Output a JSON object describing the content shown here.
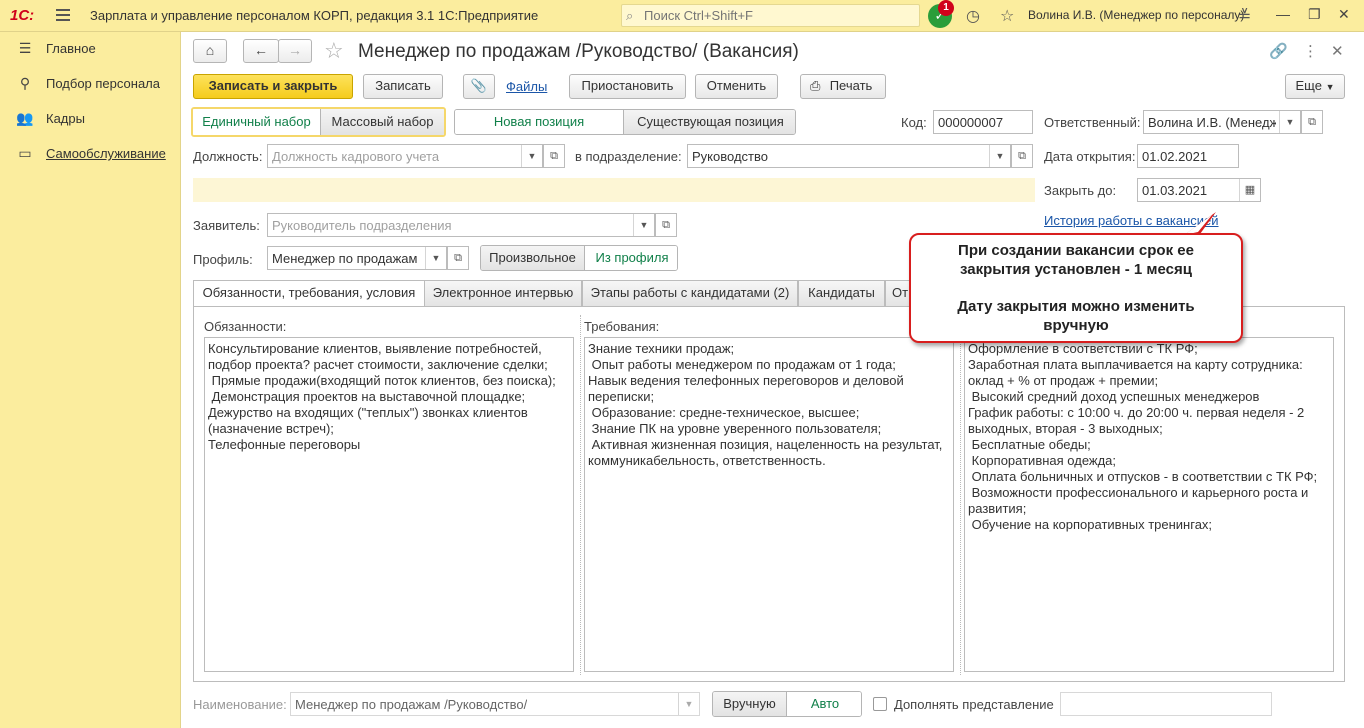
{
  "app": {
    "logo": "1С:",
    "title": "Зарплата и управление персоналом КОРП, редакция 3.1 1С:Предприятие",
    "search_placeholder": "Поиск Ctrl+Shift+F",
    "notifications_count": "1",
    "user": "Волина И.В. (Менеджер по персоналу)"
  },
  "sidebar": {
    "items": [
      {
        "label": "Главное",
        "icon": "main-menu-icon"
      },
      {
        "label": "Подбор персонала",
        "icon": "recruiting-icon"
      },
      {
        "label": "Кадры",
        "icon": "people-icon"
      },
      {
        "label": "Самообслуживание",
        "icon": "self-service-icon"
      }
    ]
  },
  "document": {
    "title": "Менеджер по продажам /Руководство/ (Вакансия)"
  },
  "toolbar": {
    "save_close": "Записать и закрыть",
    "save": "Записать",
    "files": "Файлы",
    "suspend": "Приостановить",
    "cancel": "Отменить",
    "print": "Печать",
    "more": "Еще"
  },
  "form": {
    "set_toggle": {
      "single": "Единичный набор",
      "mass": "Массовый набор"
    },
    "position_toggle": {
      "new": "Новая позиция",
      "existing": "Существующая позиция"
    },
    "code_label": "Код:",
    "code_value": "000000007",
    "responsible_label": "Ответственный:",
    "responsible_value": "Волина И.В. (Менеджер г",
    "position_label": "Должность:",
    "position_placeholder": "Должность кадрового учета",
    "department_label": "в подразделение:",
    "department_value": "Руководство",
    "open_date_label": "Дата открытия:",
    "open_date_value": "01.02.2021",
    "close_by_label": "Закрыть до:",
    "close_by_value": "01.03.2021",
    "history_link": "История работы с вакансией",
    "applicant_label": "Заявитель:",
    "applicant_placeholder": "Руководитель подразделения",
    "profile_label": "Профиль:",
    "profile_value": "Менеджер по продажам",
    "profile_toggle": {
      "custom": "Произвольное",
      "from_profile": "Из профиля"
    }
  },
  "tabs": [
    {
      "label": "Обязанности, требования, условия"
    },
    {
      "label": "Электронное интервью"
    },
    {
      "label": "Этапы работы с кандидатами (2)"
    },
    {
      "label": "Кандидаты"
    },
    {
      "label": "От"
    }
  ],
  "columns": {
    "duties_title": "Обязанности:",
    "duties_text": "Консультирование клиентов, выявление потребностей, подбор проекта? расчет стоимости, заключение сделки;\n Прямые продажи(входящий поток клиентов, без поиска);\n Демонстрация проектов на выставочной площадке;\nДежурство на входящих (\"теплых\") звонках клиентов (назначение встреч);\nТелефонные переговоры",
    "requirements_title": "Требования:",
    "requirements_text": "Знание техники продаж;\n Опыт работы менеджером по продажам от 1 года;\nНавык ведения телефонных переговоров и деловой переписки;\n Образование: средне-техническое, высшее;\n Знание ПК на уровне уверенного пользователя;\n Активная жизненная позиция, нацеленность на результат, коммуникабельность, ответственность.",
    "conditions_text": "Оформление в соответствии с ТК РФ;\nЗаработная плата выплачивается на карту сотрудника: оклад + % от продаж + премии;\n Высокий средний доход успешных менеджеров\nГрафик работы: с 10:00 ч. до 20:00 ч. первая неделя - 2 выходных, вторая - 3 выходных;\n Бесплатные обеды;\n Корпоративная одежда;\n Оплата больничных и отпусков - в соответствии с ТК РФ;\n Возможности профессионального и карьерного роста и развития;\n Обучение на корпоративных тренингах;"
  },
  "footer": {
    "name_label": "Наименование:",
    "name_value": "Менеджер по продажам /Руководство/",
    "name_toggle": {
      "manual": "Вручную",
      "auto": "Авто"
    },
    "supplement_label": "Дополнять представление"
  },
  "callout": {
    "line1": "При создании вакансии срок ее",
    "line2": "закрытия установлен - 1 месяц",
    "line3": "Дату закрытия можно изменить",
    "line4": "вручную"
  }
}
